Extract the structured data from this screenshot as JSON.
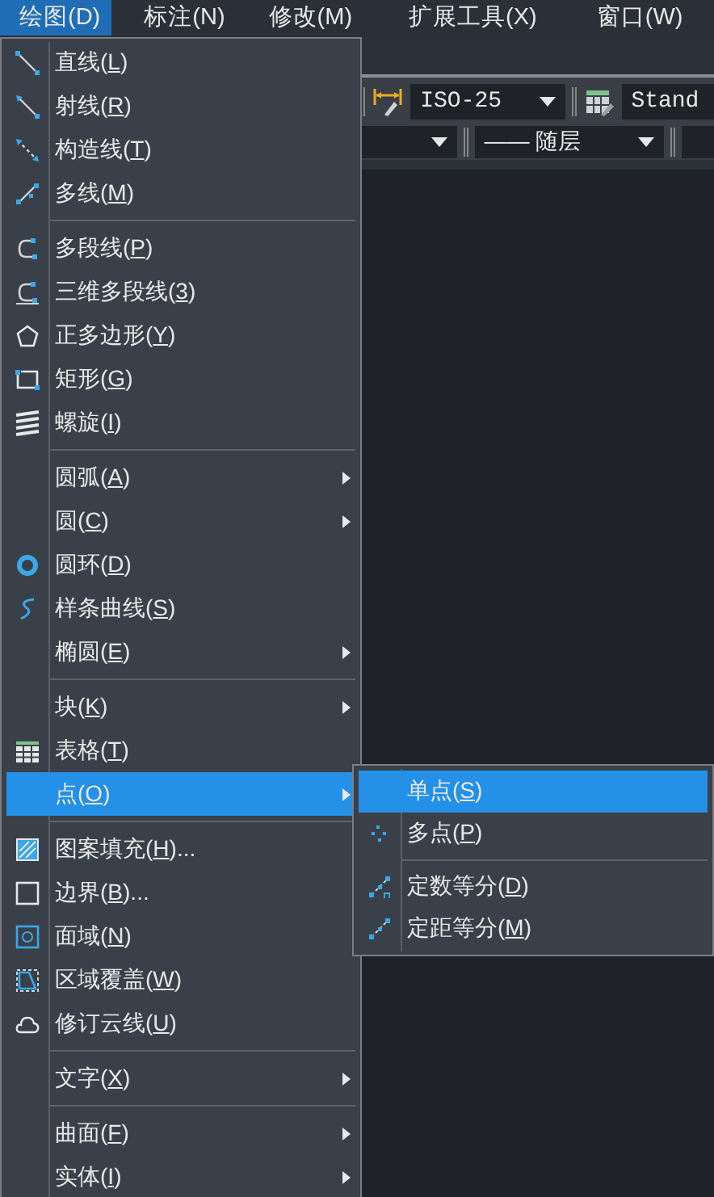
{
  "menu_bar": [
    {
      "label": "绘图(D)",
      "selected": true
    },
    {
      "label": "标注(N)",
      "selected": false
    },
    {
      "label": "修改(M)",
      "selected": false
    },
    {
      "label": "扩展工具(X)",
      "selected": false
    },
    {
      "label": "窗口(W)",
      "selected": false
    }
  ],
  "toolbar": {
    "dimension_style": "ISO-25",
    "table_style": "Stand",
    "linetype": "—— 随层"
  },
  "menu": {
    "groups": [
      [
        {
          "kind": "line",
          "label": "直线(L)",
          "submenu": false,
          "selected": false
        },
        {
          "kind": "ray",
          "label": "射线(R)",
          "submenu": false,
          "selected": false
        },
        {
          "kind": "xline",
          "label": "构造线(T)",
          "submenu": false,
          "selected": false
        },
        {
          "kind": "mline",
          "label": "多线(M)",
          "submenu": false,
          "selected": false
        }
      ],
      [
        {
          "kind": "pline",
          "label": "多段线(P)",
          "submenu": false,
          "selected": false
        },
        {
          "kind": "pline3d",
          "label": "三维多段线(3)",
          "submenu": false,
          "selected": false
        },
        {
          "kind": "polygon",
          "label": "正多边形(Y)",
          "submenu": false,
          "selected": false
        },
        {
          "kind": "rect",
          "label": "矩形(G)",
          "submenu": false,
          "selected": false
        },
        {
          "kind": "helix",
          "label": "螺旋(I)",
          "submenu": false,
          "selected": false
        }
      ],
      [
        {
          "label": "圆弧(A)",
          "submenu": true,
          "selected": false
        },
        {
          "label": "圆(C)",
          "submenu": true,
          "selected": false
        },
        {
          "kind": "donut",
          "label": "圆环(D)",
          "submenu": false,
          "selected": false
        },
        {
          "kind": "spline",
          "label": "样条曲线(S)",
          "submenu": false,
          "selected": false
        },
        {
          "label": "椭圆(E)",
          "submenu": true,
          "selected": false
        }
      ],
      [
        {
          "label": "块(K)",
          "submenu": true,
          "selected": false
        },
        {
          "kind": "table",
          "label": "表格(T)",
          "submenu": false,
          "selected": false
        },
        {
          "label": "点(O)",
          "submenu": true,
          "selected": true
        }
      ],
      [
        {
          "kind": "hatch",
          "label": "图案填充(H)...",
          "submenu": false,
          "selected": false
        },
        {
          "kind": "boundary",
          "label": "边界(B)...",
          "submenu": false,
          "selected": false
        },
        {
          "kind": "region",
          "label": "面域(N)",
          "submenu": false,
          "selected": false
        },
        {
          "kind": "wipeout",
          "label": "区域覆盖(W)",
          "submenu": false,
          "selected": false
        },
        {
          "kind": "cloud",
          "label": "修订云线(U)",
          "submenu": false,
          "selected": false
        }
      ],
      [
        {
          "label": "文字(X)",
          "submenu": true,
          "selected": false
        }
      ],
      [
        {
          "label": "曲面(F)",
          "submenu": true,
          "selected": false
        },
        {
          "label": "实体(I)",
          "submenu": true,
          "selected": false
        }
      ]
    ]
  },
  "submenu": {
    "groups": [
      [
        {
          "label": "单点(S)",
          "submenu": false,
          "selected": true
        },
        {
          "kind": "multipoint",
          "label": "多点(P)",
          "submenu": false,
          "selected": false
        }
      ],
      [
        {
          "kind": "divide",
          "label": "定数等分(D)",
          "submenu": false,
          "selected": false
        },
        {
          "kind": "measure",
          "label": "定距等分(M)",
          "submenu": false,
          "selected": false
        }
      ]
    ]
  }
}
